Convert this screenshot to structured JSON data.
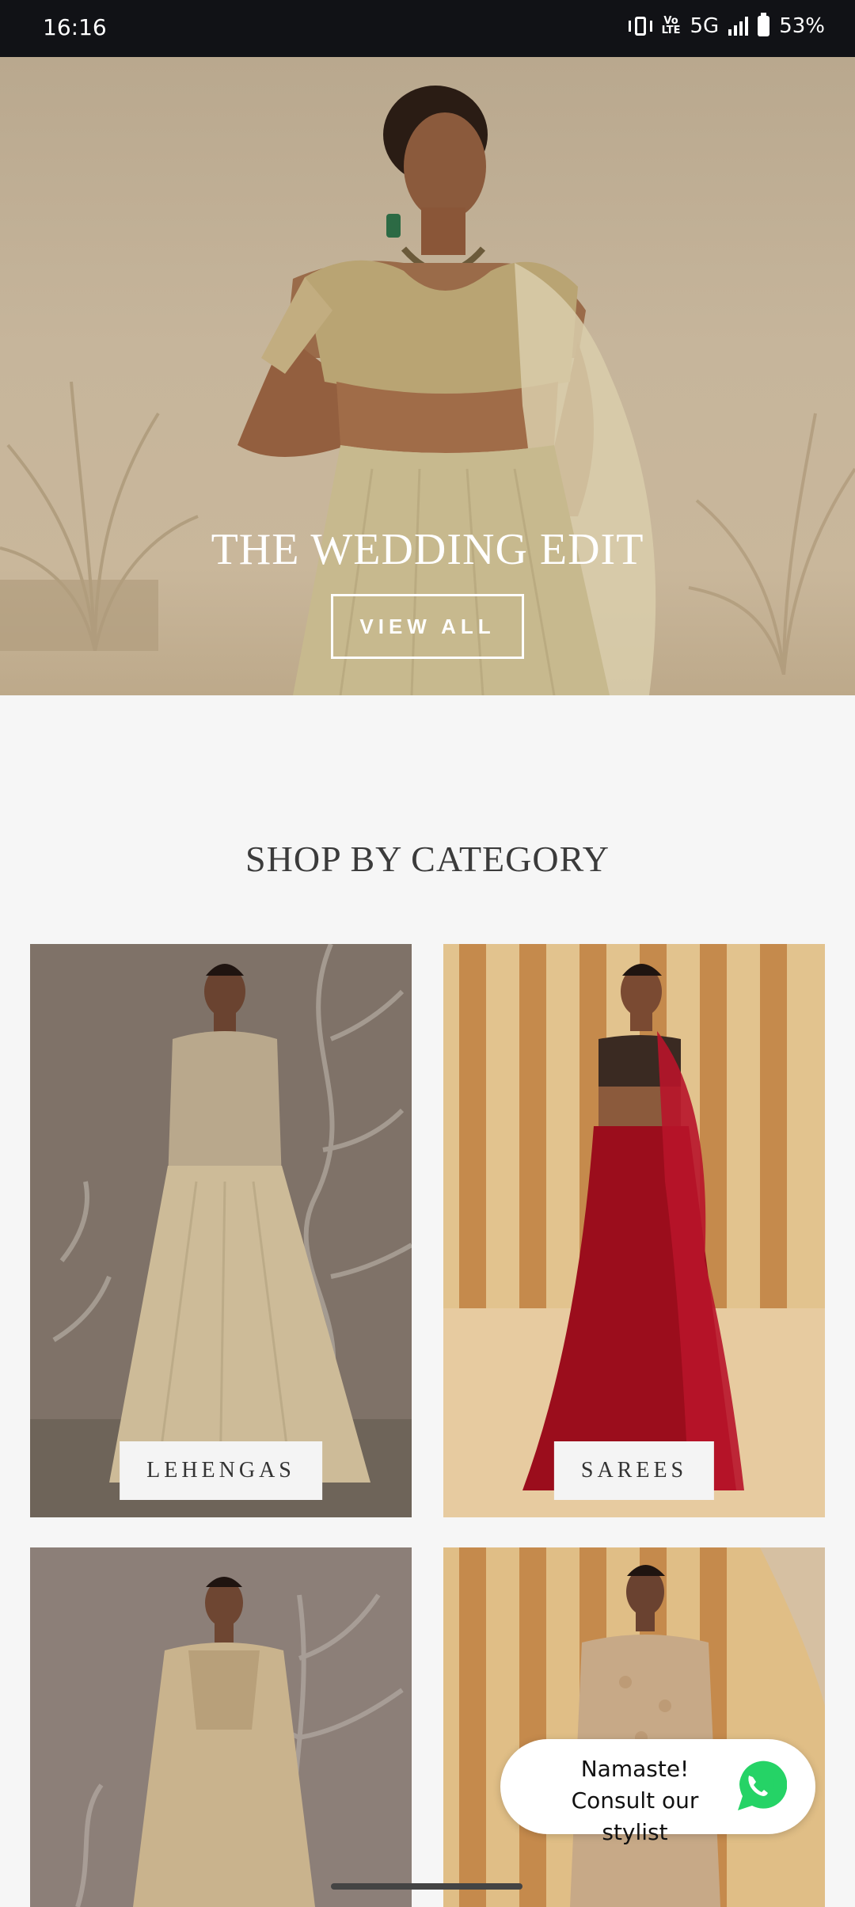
{
  "status_bar": {
    "time": "16:16",
    "network": "5G",
    "volte": "VoLTE",
    "battery": "53%"
  },
  "hero": {
    "title": "THE WEDDING EDIT",
    "button_label": "VIEW ALL"
  },
  "section": {
    "title": "SHOP BY CATEGORY"
  },
  "categories": [
    {
      "label": "LEHENGAS"
    },
    {
      "label": "SAREES"
    },
    {
      "label": ""
    },
    {
      "label": ""
    }
  ],
  "whatsapp": {
    "line1": "Namaste!",
    "line2": "Consult our stylist",
    "icon": "whatsapp-icon"
  },
  "colors": {
    "status_bar": "#111216",
    "background": "#f6f6f6",
    "whatsapp_green": "#25D366"
  }
}
